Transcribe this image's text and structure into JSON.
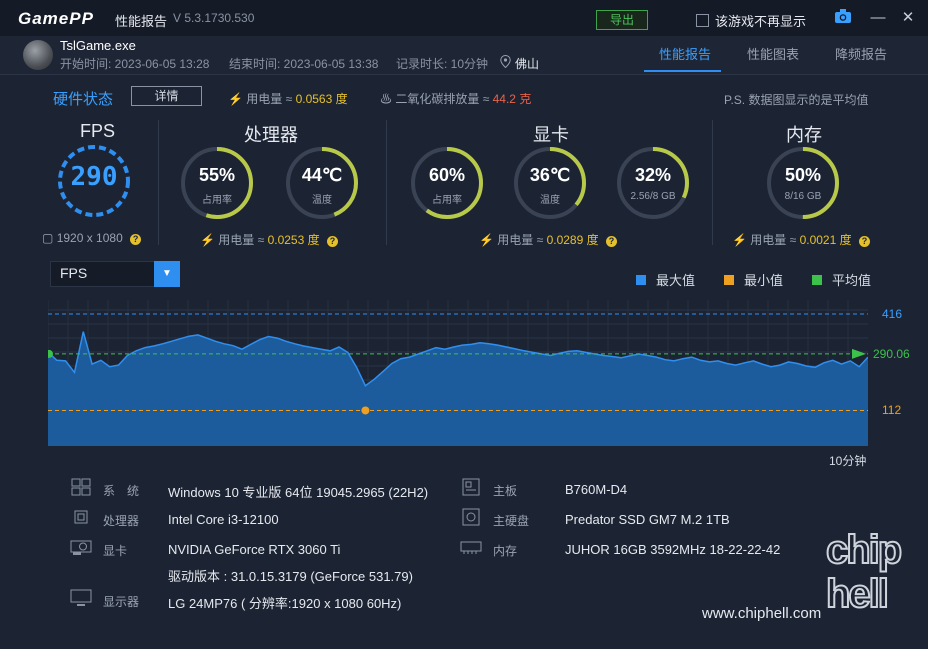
{
  "app": {
    "logo": "GamePP",
    "title": "性能报告",
    "version": "V 5.3.1730.530",
    "export_label": "导出",
    "no_show_label": "该游戏不再显示"
  },
  "session": {
    "game": "TslGame.exe",
    "start": "开始时间: 2023-06-05 13:28",
    "end": "结束时间: 2023-06-05 13:38",
    "duration": "记录时长: 10分钟",
    "city": "佛山"
  },
  "tabs": [
    {
      "label": "性能报告",
      "active": true
    },
    {
      "label": "性能图表",
      "active": false
    },
    {
      "label": "降频报告",
      "active": false
    }
  ],
  "status": {
    "title": "硬件状态",
    "detail_label": "详情",
    "power_label": "用电量 ≈",
    "power_value": "0.0563 度",
    "co2_label": "二氧化碳排放量 ≈",
    "co2_value": "44.2 克",
    "note": "P.S. 数据图显示的是平均值"
  },
  "fps": {
    "title": "FPS",
    "value": "290",
    "resolution": "1920 x 1080"
  },
  "cpu": {
    "title": "处理器",
    "usage": {
      "value": "55%",
      "label": "占用率",
      "pct": 55
    },
    "temp": {
      "value": "44℃",
      "label": "温度",
      "pct": 44
    },
    "power_label": "用电量 ≈",
    "power_value": "0.0253 度"
  },
  "gpu": {
    "title": "显卡",
    "usage": {
      "value": "60%",
      "label": "占用率",
      "pct": 60
    },
    "temp": {
      "value": "36℃",
      "label": "温度",
      "pct": 36
    },
    "vram": {
      "value": "32%",
      "label": "2.56/8 GB",
      "pct": 32
    },
    "power_label": "用电量 ≈",
    "power_value": "0.0289 度"
  },
  "mem": {
    "title": "内存",
    "usage": {
      "value": "50%",
      "label": "8/16 GB",
      "pct": 50
    },
    "power_label": "用电量 ≈",
    "power_value": "0.0021 度"
  },
  "chart_controls": {
    "selected_metric": "FPS",
    "legend": [
      {
        "label": "最大值",
        "color": "#2f8ff0"
      },
      {
        "label": "最小值",
        "color": "#f0a020"
      },
      {
        "label": "平均值",
        "color": "#3cc24a"
      }
    ]
  },
  "chart_data": {
    "type": "area",
    "series": [
      {
        "name": "FPS",
        "values": [
          296,
          270,
          268,
          232,
          360,
          258,
          270,
          250,
          255,
          285,
          300,
          310,
          315,
          322,
          330,
          338,
          346,
          350,
          340,
          330,
          322,
          316,
          305,
          320,
          335,
          345,
          340,
          330,
          322,
          315,
          310,
          305,
          300,
          312,
          295,
          248,
          190,
          210,
          235,
          260,
          275,
          280,
          290,
          300,
          310,
          305,
          312,
          318,
          320,
          325,
          322,
          318,
          312,
          306,
          300,
          295,
          290,
          285,
          292,
          298,
          300,
          295,
          290,
          285,
          282,
          278,
          284,
          290,
          285,
          280,
          272,
          268,
          275,
          280,
          270,
          265,
          268,
          260,
          255,
          262,
          268,
          258,
          250,
          255,
          265,
          260,
          252,
          248,
          262,
          270,
          258,
          268,
          250,
          280
        ]
      }
    ],
    "x": {
      "label": "10分钟"
    },
    "max": 416,
    "min": 112,
    "avg": 290.06,
    "ylim": [
      0,
      460
    ]
  },
  "sysinfo": {
    "left": [
      {
        "icon": "windows-icon",
        "label": "系　统",
        "value": "Windows 10 专业版 64位 19045.2965 (22H2)"
      },
      {
        "icon": "cpu-icon",
        "label": "处理器",
        "value": "Intel Core i3-12100"
      },
      {
        "icon": "gpu-icon",
        "label": "显卡",
        "value": "NVIDIA GeForce RTX 3060 Ti"
      },
      {
        "icon": "",
        "label": "",
        "value": "驱动版本 : 31.0.15.3179 (GeForce 531.79)"
      },
      {
        "icon": "monitor-icon",
        "label": "显示器",
        "value": "LG 24MP76 ( 分辨率:1920 x 1080 60Hz)"
      }
    ],
    "right": [
      {
        "icon": "motherboard-icon",
        "label": "主板",
        "value": "B760M-D4"
      },
      {
        "icon": "disk-icon",
        "label": "主硬盘",
        "value": "Predator SSD GM7 M.2 1TB"
      },
      {
        "icon": "memory-icon",
        "label": "内存",
        "value": "JUHOR 16GB 3592MHz 18-22-22-42"
      }
    ]
  },
  "watermark": {
    "url": "www.chiphell.com",
    "logo": "chip hell"
  }
}
